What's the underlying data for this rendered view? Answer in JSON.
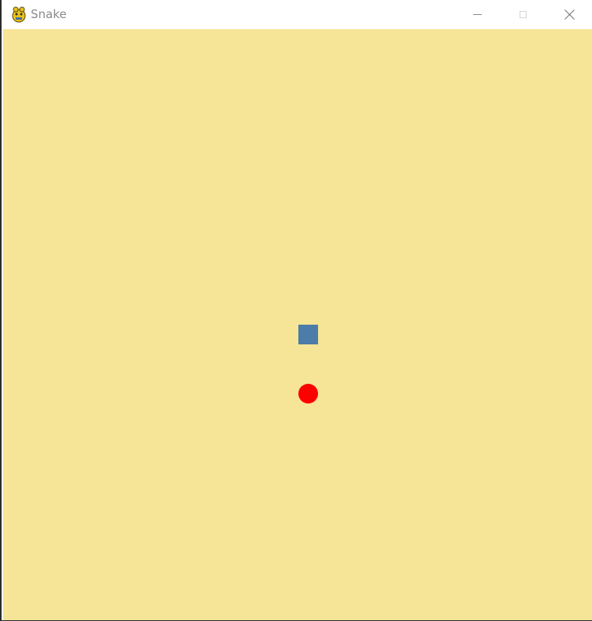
{
  "window": {
    "title": "Snake",
    "icon": "pygame-snake-icon",
    "controls": {
      "minimize": "minimize-icon",
      "maximize": "maximize-icon",
      "close": "close-icon"
    }
  },
  "game": {
    "background_color": "#f6e497",
    "snake": {
      "color": "#4c7ca8",
      "segments": [
        {
          "col": 15,
          "row": 15
        }
      ]
    },
    "food": {
      "color": "#ff0000",
      "col": 15,
      "row": 18
    }
  }
}
